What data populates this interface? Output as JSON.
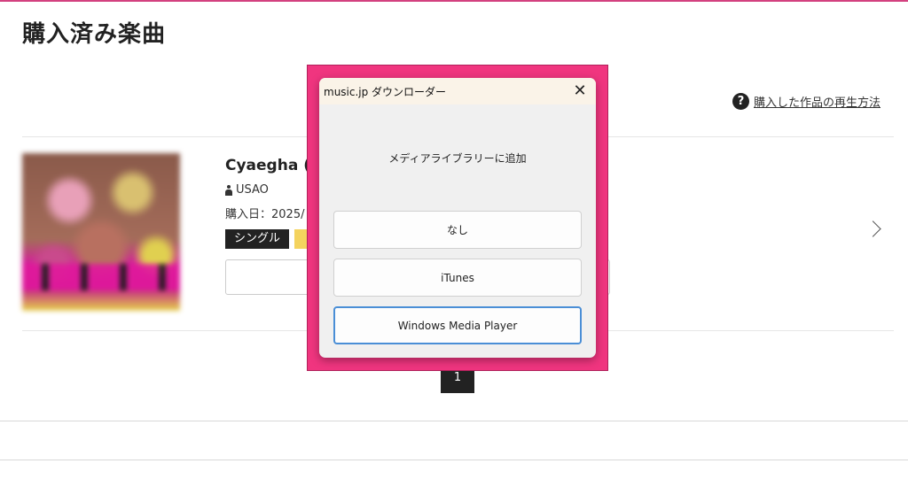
{
  "page": {
    "title": "購入済み楽曲",
    "help_link": "購入した作品の再生方法",
    "help_icon": "?"
  },
  "item": {
    "title": "Cyaegha (E",
    "artist": "USAO",
    "purchase_date": "購入日：2025/",
    "tag": "シングル"
  },
  "pagination": {
    "current": "1"
  },
  "dialog": {
    "title": "music.jp ダウンローダー",
    "close": "✕",
    "message": "メディアライブラリーに追加",
    "buttons": [
      "なし",
      "iTunes",
      "Windows Media Player"
    ]
  },
  "colors": {
    "accent": "#d3417f",
    "dialog_frame": "#f0357f",
    "focus": "#4a8ed6"
  }
}
